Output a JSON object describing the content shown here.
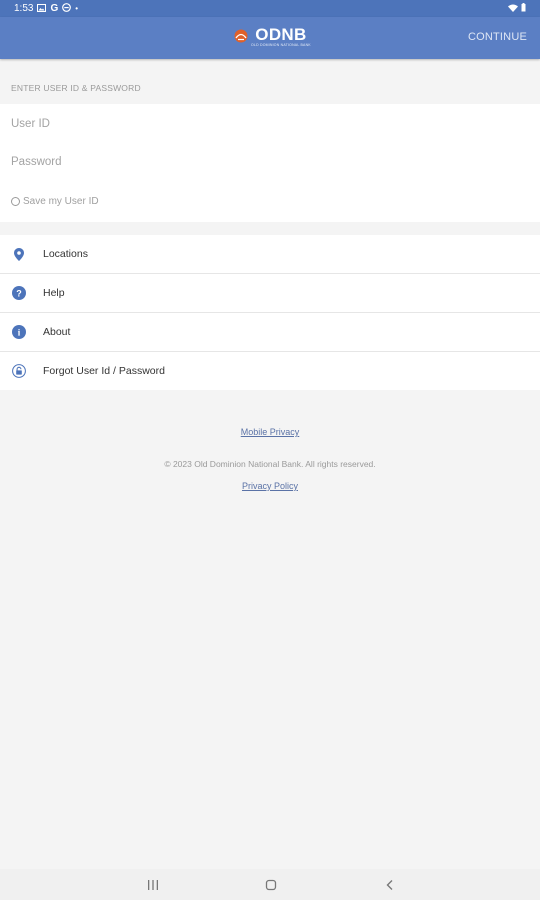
{
  "status_bar": {
    "time": "1:53",
    "left_icons": [
      "image-icon",
      "google-icon",
      "vpn-icon",
      "dot-icon"
    ],
    "right_icons": [
      "wifi-icon",
      "battery-icon"
    ]
  },
  "app_bar": {
    "logo_text": "ODNB",
    "logo_tagline": "OLD DOMINION NATIONAL BANK",
    "continue_label": "CONTINUE",
    "color": "#5b7fc4"
  },
  "login": {
    "section_header": "ENTER USER ID & PASSWORD",
    "user_id_placeholder": "User ID",
    "user_id_value": "",
    "password_placeholder": "Password",
    "password_value": "",
    "save_user_id_label": "Save my User ID",
    "save_user_id_checked": false
  },
  "menu": {
    "items": [
      {
        "label": "Locations",
        "icon": "location-pin-icon"
      },
      {
        "label": "Help",
        "icon": "help-icon"
      },
      {
        "label": "About",
        "icon": "info-icon"
      },
      {
        "label": "Forgot User Id / Password",
        "icon": "lock-icon"
      }
    ],
    "icon_color": "#4d74ba"
  },
  "footer": {
    "mobile_privacy": "Mobile Privacy",
    "copyright": "© 2023 Old Dominion National Bank. All rights reserved.",
    "privacy_policy": "Privacy Policy",
    "link_color": "#5a72a6"
  },
  "nav_bar": {
    "buttons": [
      "recents-icon",
      "home-icon",
      "back-icon"
    ]
  }
}
